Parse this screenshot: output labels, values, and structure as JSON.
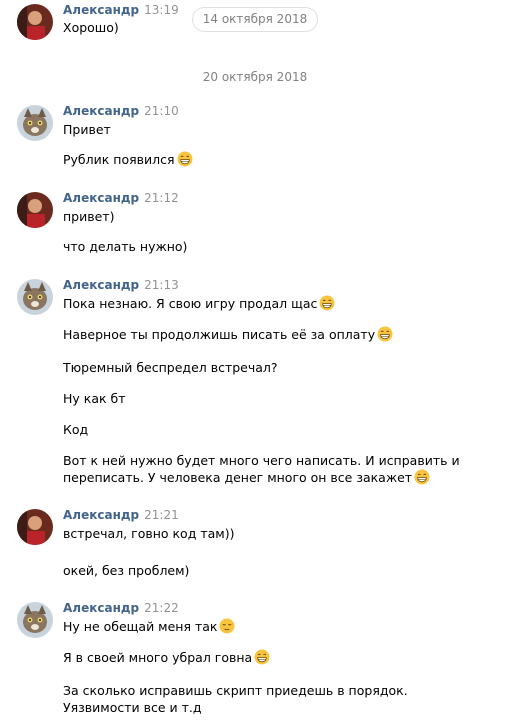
{
  "floating_date": "14 октября 2018",
  "date_separator": "20 октября 2018",
  "groups": [
    {
      "author": "Александр",
      "time": "13:19",
      "avatar": "person-photo",
      "lines": [
        {
          "text": "Хорошо)",
          "emoji": null
        }
      ]
    },
    {
      "author": "Александр",
      "time": "21:10",
      "avatar": "cat-photo",
      "lines": [
        {
          "text": "Привет",
          "emoji": null
        },
        {
          "text": "Рублик появился",
          "emoji": "grin"
        }
      ]
    },
    {
      "author": "Александр",
      "time": "21:12",
      "avatar": "person-photo",
      "lines": [
        {
          "text": "привет)",
          "emoji": null
        },
        {
          "text": "что делать нужно)",
          "emoji": null
        }
      ]
    },
    {
      "author": "Александр",
      "time": "21:13",
      "avatar": "cat-photo",
      "lines": [
        {
          "text": "Пока незнаю. Я свою игру продал щас",
          "emoji": "grin"
        },
        {
          "text": "Наверное ты продолжишь писать её за оплату",
          "emoji": "grin"
        },
        {
          "text": "Тюремный беспредел встречал?",
          "emoji": null
        },
        {
          "text": "Ну как бт",
          "emoji": null
        },
        {
          "text": "Код",
          "emoji": null
        },
        {
          "text": "Вот к ней нужно будет много чего написать. И исправить и",
          "emoji": null
        },
        {
          "text": "переписать. У человека денег много он все закажет",
          "emoji": "grin"
        }
      ]
    },
    {
      "author": "Александр",
      "time": "21:21",
      "avatar": "person-photo",
      "lines": [
        {
          "text": "встречал, говно код там))",
          "emoji": null
        },
        {
          "text": "окей, без проблем)",
          "emoji": null
        }
      ]
    },
    {
      "author": "Александр",
      "time": "21:22",
      "avatar": "cat-photo",
      "lines": [
        {
          "text": "Ну не обещай меня так",
          "emoji": "relieved"
        },
        {
          "text": "Я в своей много убрал говна",
          "emoji": "grin"
        },
        {
          "text": "За сколько исправишь скрипт приедешь в порядок.",
          "emoji": null
        },
        {
          "text": "Уязвимости все и т.д",
          "emoji": null
        }
      ]
    }
  ]
}
